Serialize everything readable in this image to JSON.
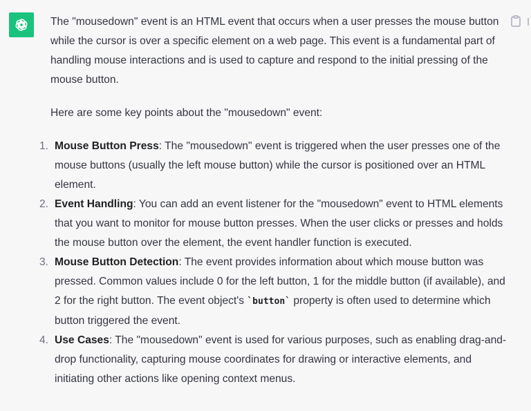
{
  "avatar": {
    "icon": "openai-logo-icon",
    "color": "#19c37d"
  },
  "actions": {
    "copy_icon": "clipboard-icon"
  },
  "message": {
    "intro": "The \"mousedown\" event is an HTML event that occurs when a user presses the mouse button while the cursor is over a specific element on a web page. This event is a fundamental part of handling mouse interactions and is used to capture and respond to the initial pressing of the mouse button.",
    "lead": "Here are some key points about the \"mousedown\" event:",
    "items": [
      {
        "number": "1.",
        "title": "Mouse Button Press",
        "text": ": The \"mousedown\" event is triggered when the user presses one of the mouse buttons (usually the left mouse button) while the cursor is positioned over an HTML element."
      },
      {
        "number": "2.",
        "title": "Event Handling",
        "text": ": You can add an event listener for the \"mousedown\" event to HTML elements that you want to monitor for mouse button presses. When the user clicks or presses and holds the mouse button over the element, the event handler function is executed."
      },
      {
        "number": "3.",
        "title": "Mouse Button Detection",
        "text_before": ": The event provides information about which mouse button was pressed. Common values include 0 for the left button, 1 for the middle button (if available), and 2 for the right button. The event object's ",
        "code": "`button`",
        "text_after": " property is often used to determine which button triggered the event."
      },
      {
        "number": "4.",
        "title": "Use Cases",
        "text": ": The \"mousedown\" event is used for various purposes, such as enabling drag-and-drop functionality, capturing mouse coordinates for drawing or interactive elements, and initiating other actions like opening context menus."
      }
    ]
  }
}
